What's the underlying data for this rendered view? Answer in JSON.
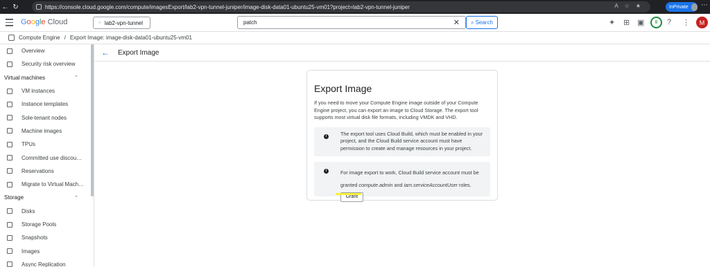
{
  "browser": {
    "url": "https://console.cloud.google.com/compute/imagesExport/lab2-vpn-tunnel-juniper/image-disk-data01-ubuntu25-vm01?project=lab2-vpn-tunnel-juniper",
    "inprivate_label": "InPrivate"
  },
  "header": {
    "logo_g": [
      "G",
      "o",
      "o",
      "g",
      "l",
      "e"
    ],
    "logo_cloud": "Cloud",
    "project": "lab2-vpn-tunnel",
    "search_value": "patch",
    "search_button": "Search",
    "notification_count": "8",
    "avatar_letter": "M"
  },
  "breadcrumb": {
    "root": "Compute Engine",
    "separator": "/",
    "current": "Export Image: image-disk-data01-ubuntu25-vm01"
  },
  "sidebar": {
    "top_items": [
      "Overview",
      "Security risk overview"
    ],
    "sections": [
      {
        "title": "Virtual machines",
        "items": [
          "VM instances",
          "Instance templates",
          "Sole-tenant nodes",
          "Machine images",
          "TPUs",
          "Committed use discou…",
          "Reservations",
          "Migrate to Virtual Mach…"
        ]
      },
      {
        "title": "Storage",
        "items": [
          "Disks",
          "Storage Pools",
          "Snapshots",
          "Images",
          "Async Replication"
        ]
      }
    ]
  },
  "main": {
    "page_title": "Export Image",
    "card": {
      "title": "Export Image",
      "description": "If you need to move your Compute Engine image outside of your Compute Engine project, you can export an image to Cloud Storage. The export tool supports most virtual disk file formats, including VMDK and VHD.",
      "note1": "The export tool uses Cloud Build, which must be enabled in your project, and the Cloud Build service account must have permission to create and manage resources in your project.",
      "note2_prefix": "For image export to work, Cloud Build service account must be granted ",
      "note2_role1": "compute.admin",
      "note2_and": " and ",
      "note2_role2": "iam.serviceAccountUser",
      "note2_suffix": " roles.",
      "grant_button": "Grant"
    }
  },
  "colors": {
    "accent": "#1a73e8",
    "highlight": "#f7f13b",
    "avatar": "#c5221f"
  }
}
